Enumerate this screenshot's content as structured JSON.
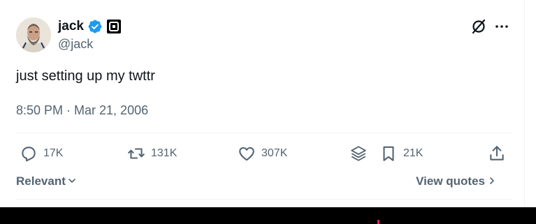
{
  "author": {
    "name": "jack",
    "handle": "@jack",
    "avatar_icon": "avatar-photo",
    "verified_icon": "verified-badge-icon",
    "affiliation_icon": "square-logo-icon"
  },
  "tweet": {
    "text": "just setting up my twttr",
    "timestamp": "8:50 PM · Mar 21, 2006"
  },
  "actions": {
    "replies": "17K",
    "retweets": "131K",
    "likes": "307K",
    "bookmarks": "21K"
  },
  "sort": {
    "label": "Relevant"
  },
  "quotes": {
    "label": "View quotes"
  },
  "colors": {
    "text": "#0f1419",
    "secondary": "#536471",
    "verified": "#1d9bf0",
    "divider": "#eff3f4"
  }
}
